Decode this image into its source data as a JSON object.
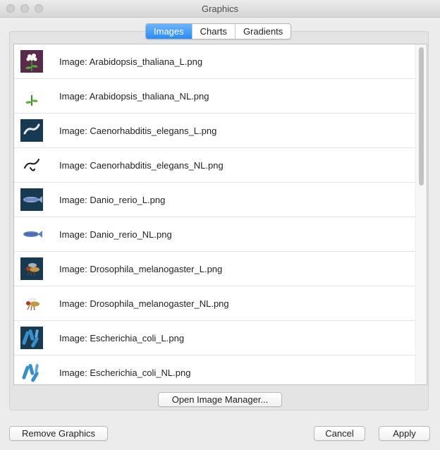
{
  "window": {
    "title": "Graphics"
  },
  "tabs": [
    {
      "label": "Images",
      "active": true
    },
    {
      "label": "Charts",
      "active": false
    },
    {
      "label": "Gradients",
      "active": false
    }
  ],
  "images": [
    {
      "label": "Image: Arabidopsis_thaliana_L.png",
      "icon": "arabidopsis-icon",
      "dark": true
    },
    {
      "label": "Image: Arabidopsis_thaliana_NL.png",
      "icon": "arabidopsis-icon",
      "dark": false
    },
    {
      "label": "Image: Caenorhabditis_elegans_L.png",
      "icon": "worm-icon",
      "dark": true
    },
    {
      "label": "Image: Caenorhabditis_elegans_NL.png",
      "icon": "worm-icon",
      "dark": false
    },
    {
      "label": "Image: Danio_rerio_L.png",
      "icon": "fish-icon",
      "dark": true
    },
    {
      "label": "Image: Danio_rerio_NL.png",
      "icon": "fish-icon",
      "dark": false
    },
    {
      "label": "Image: Drosophila_melanogaster_L.png",
      "icon": "fly-icon",
      "dark": true
    },
    {
      "label": "Image: Drosophila_melanogaster_NL.png",
      "icon": "fly-icon",
      "dark": false
    },
    {
      "label": "Image: Escherichia_coli_L.png",
      "icon": "bacteria-icon",
      "dark": true
    },
    {
      "label": "Image: Escherichia_coli_NL.png",
      "icon": "bacteria-icon",
      "dark": false
    }
  ],
  "buttons": {
    "open_manager": "Open Image Manager...",
    "remove": "Remove Graphics",
    "cancel": "Cancel",
    "apply": "Apply"
  },
  "colors": {
    "accent": "#2a8cf6",
    "thumb_dark": "#173a52",
    "thumb_plant_dark": "#5a2a4a"
  }
}
